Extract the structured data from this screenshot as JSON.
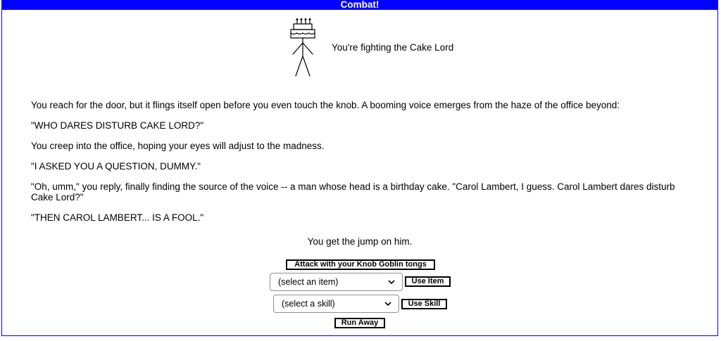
{
  "window": {
    "title": "Combat!"
  },
  "combat": {
    "monster_text": "You're fighting the Cake Lord",
    "monster_icon": "cake-lord-stick-figure-icon"
  },
  "story": {
    "paragraphs": [
      "You reach for the door, but it flings itself open before you even touch the knob. A booming voice emerges from the haze of the office beyond:",
      "\"WHO DARES DISTURB CAKE LORD?\"",
      "You creep into the office, hoping your eyes will adjust to the madness.",
      "\"I ASKED YOU A QUESTION, DUMMY.\"",
      "\"Oh, umm,\" you reply, finally finding the source of the voice -- a man whose head is a birthday cake. \"Carol Lambert, I guess. Carol Lambert dares disturb Cake Lord?\"",
      "\"THEN CAROL LAMBERT... IS A FOOL.\""
    ],
    "status": "You get the jump on him."
  },
  "actions": {
    "attack_label": "Attack with your Knob Goblin tongs",
    "item_select_value": "(select an item)",
    "use_item_label": "Use Item",
    "skill_select_value": "(select a skill)",
    "use_skill_label": "Use Skill",
    "run_away_label": "Run Away"
  },
  "colors": {
    "title_bar": "#0000ff",
    "frame_border": "#0000ff"
  }
}
